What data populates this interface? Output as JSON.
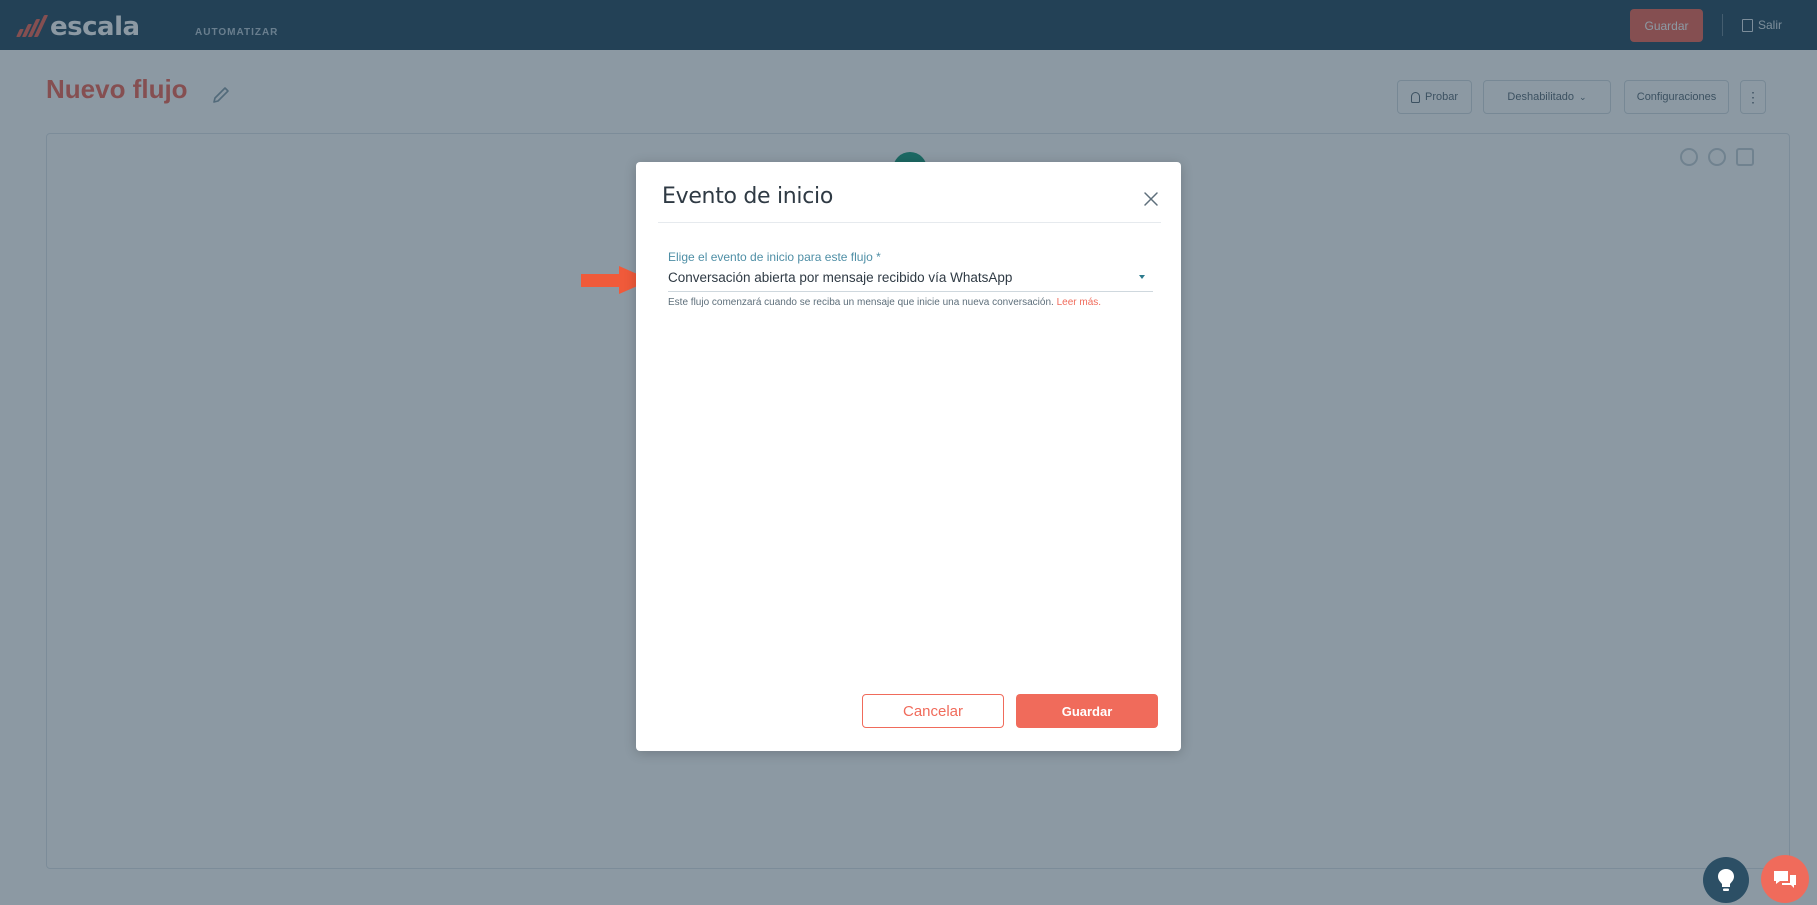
{
  "app": {
    "logo_text": "escala",
    "section": "AUTOMATIZAR",
    "save_label": "Guardar",
    "exit_label": "Salir"
  },
  "page": {
    "title": "Nuevo flujo",
    "actions": {
      "test_label": "Probar",
      "status_label": "Deshabilitado",
      "settings_label": "Configuraciones"
    }
  },
  "modal": {
    "title": "Evento de inicio",
    "field": {
      "label": "Elige el evento de inicio para este flujo *",
      "value": "Conversación abierta por mensaje recibido vía WhatsApp",
      "helper": "Este flujo comenzará cuando se reciba un mensaje que inicie una nueva conversación.",
      "helper_link": "Leer más."
    },
    "buttons": {
      "cancel": "Cancelar",
      "save": "Guardar"
    }
  },
  "colors": {
    "brand": "#f06b5b",
    "navy": "#2c4f65",
    "annotation_arrow": "#f05a3a"
  },
  "icons": [
    "pencil-icon",
    "close-icon",
    "chevron-down-icon",
    "arrow-annotation-icon",
    "lightbulb-icon",
    "chat-icon",
    "exit-icon"
  ]
}
